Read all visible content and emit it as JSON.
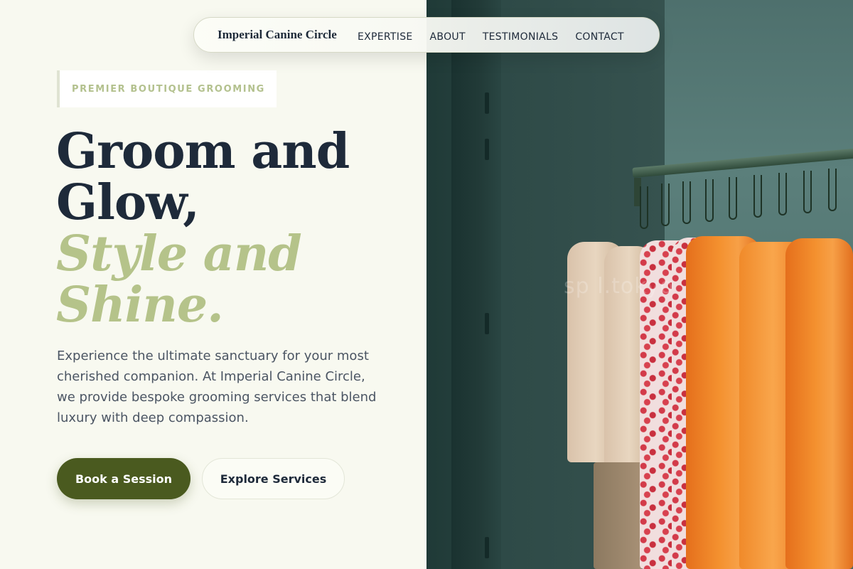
{
  "nav": {
    "brand": "Imperial Canine Circle",
    "links": [
      "EXPERTISE",
      "ABOUT",
      "TESTIMONIALS",
      "CONTACT"
    ]
  },
  "hero": {
    "eyebrow": "PREMIER BOUTIQUE GROOMING",
    "headline_line1": "Groom and",
    "headline_line2": "Glow,",
    "headline_accent_line1": "Style and",
    "headline_accent_line2": "Shine.",
    "lede": "Experience the ultimate sanctuary for your most cherished companion. At Imperial Canine Circle, we provide bespoke grooming services that blend luxury with deep compassion.",
    "primary_cta": "Book a Session",
    "secondary_cta": "Explore Services"
  },
  "photo": {
    "watermark": "sp             l.tokyo"
  },
  "colors": {
    "page_bg": "#f8f9f0",
    "heading": "#1e2a3a",
    "accent_green": "#b5c38a",
    "primary_button": "#4a5a1f",
    "eyebrow_text": "#b3c18e"
  }
}
